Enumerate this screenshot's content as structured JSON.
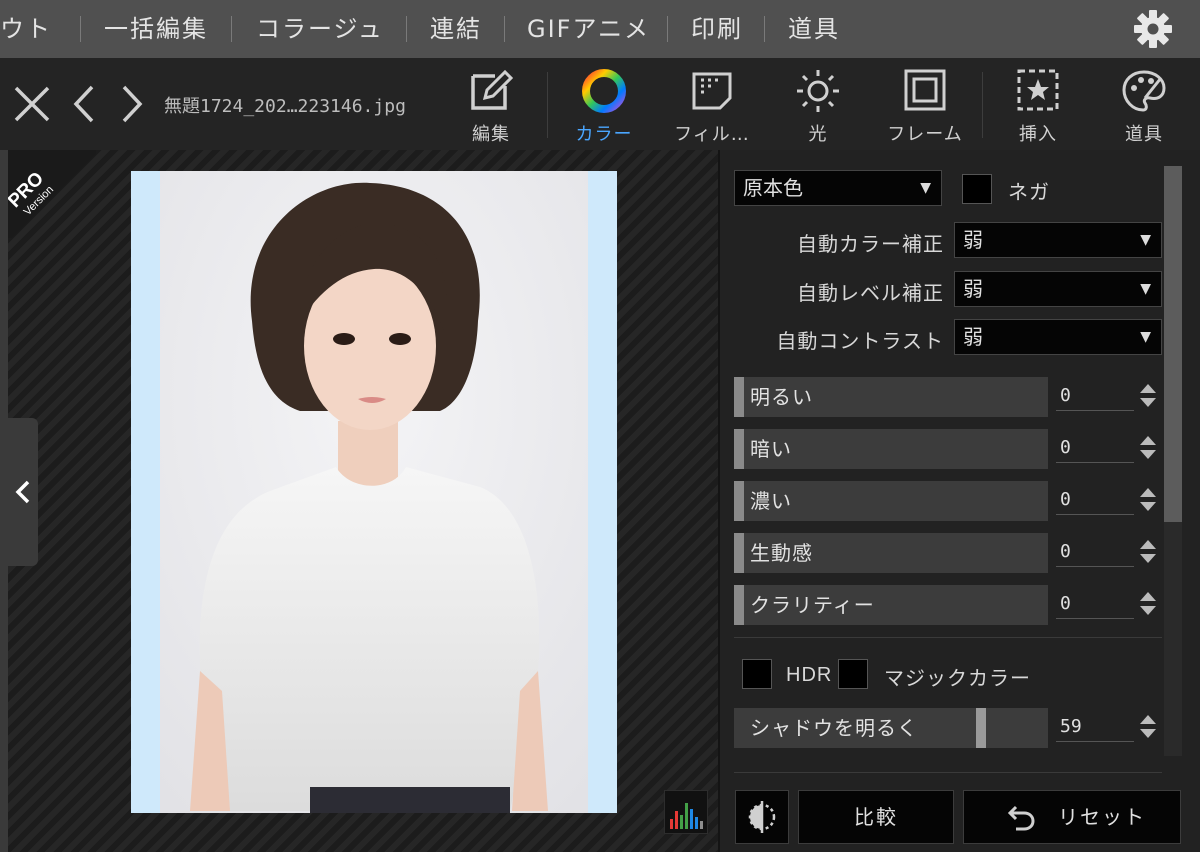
{
  "menu": {
    "items": [
      {
        "label": "ウト"
      },
      {
        "label": "一括編集"
      },
      {
        "label": "コラージュ"
      },
      {
        "label": "連結"
      },
      {
        "label": "GIFアニメ"
      },
      {
        "label": "印刷"
      },
      {
        "label": "道具"
      }
    ],
    "settings_icon": "gear-icon"
  },
  "toolbar": {
    "filename": "無題1724_202…223146.jpg",
    "tools": [
      {
        "label": "編集",
        "icon": "edit-icon"
      },
      {
        "label": "カラー",
        "icon": "color-wheel-icon",
        "active": true
      },
      {
        "label": "フィル…",
        "icon": "filter-icon"
      },
      {
        "label": "光",
        "icon": "sun-icon"
      },
      {
        "label": "フレーム",
        "icon": "frame-icon"
      },
      {
        "label": "挿入",
        "icon": "insert-icon"
      },
      {
        "label": "道具",
        "icon": "palette-icon"
      }
    ]
  },
  "badge": {
    "line1": "PRO",
    "line2": "Version"
  },
  "panel": {
    "preset": {
      "value": "原本色"
    },
    "nega_label": "ネガ",
    "auto_rows": [
      {
        "label": "自動カラー補正",
        "value": "弱"
      },
      {
        "label": "自動レベル補正",
        "value": "弱"
      },
      {
        "label": "自動コントラスト",
        "value": "弱"
      }
    ],
    "sliders": [
      {
        "label": "明るい",
        "value": "0"
      },
      {
        "label": "暗い",
        "value": "0"
      },
      {
        "label": "濃い",
        "value": "0"
      },
      {
        "label": "生動感",
        "value": "0"
      },
      {
        "label": "クラリティー",
        "value": "0"
      }
    ],
    "hdr_label": "HDR",
    "magic_label": "マジックカラー",
    "shadow": {
      "label": "シャドウを明るく",
      "value": "59",
      "level": 0.59
    },
    "compare_label": "比較",
    "reset_label": "リセット"
  },
  "colors": {
    "accent": "#4aa6ff",
    "menu_bg": "#505050",
    "panel_bg": "#222222"
  }
}
